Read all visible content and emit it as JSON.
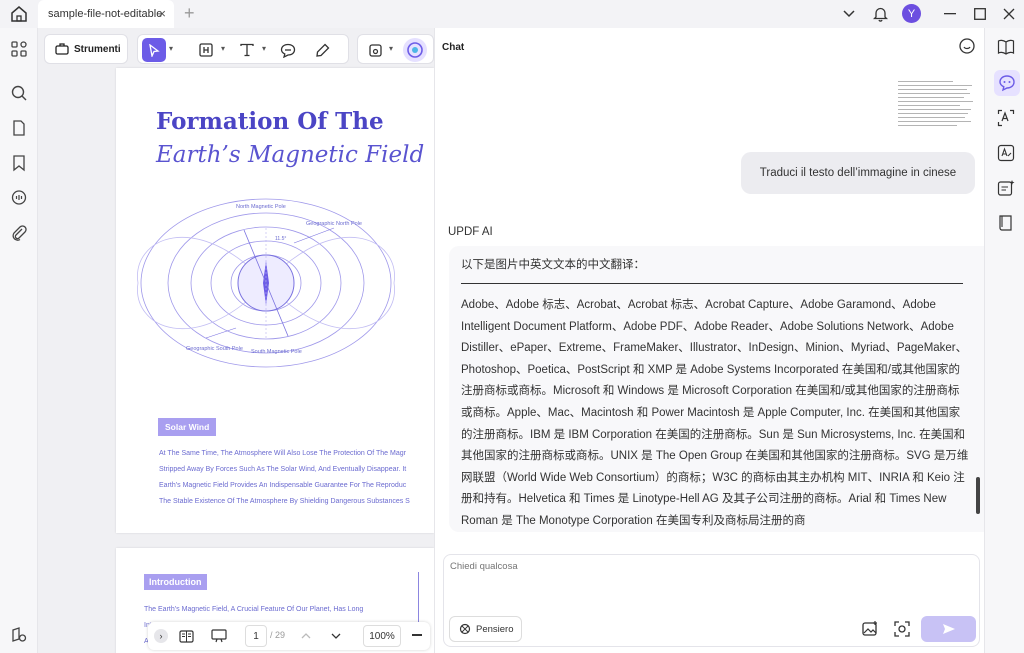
{
  "tab": {
    "title": "sample-file-not-editable"
  },
  "toolbar": {
    "strumenti_label": "Strumenti"
  },
  "document": {
    "page1": {
      "title_line1": "Formation Of The",
      "title_line2": "Earth’s Magnetic Field",
      "diagram_labels": {
        "north_magnetic_pole": "North Magnetic Pole",
        "geographic_north_pole": "Geographic North Pole",
        "geographic_south_pole": "Geographic South Pole",
        "south_magnetic_pole": "South Magnetic Pole",
        "angle": "11.5°"
      },
      "solar_wind_label": "Solar Wind",
      "body_lines": [
        "At The Same Time, The Atmosphere Will Also Lose The Protection Of The Magr",
        "Stripped Away By Forces Such As The Solar Wind, And Eventually Disappear. It",
        "Earth’s Magnetic Field Provides An Indispensable Guarantee For The Reproduc",
        "The Stable Existence Of The Atmosphere By Shielding Dangerous Substances S"
      ]
    },
    "page2": {
      "introduction_label": "Introduction",
      "body_lines": [
        "The Earth’s Magnetic Field, A Crucial Feature Of Our Planet, Has Long",
        "Int",
        "An"
      ]
    }
  },
  "pagenav": {
    "current_page": "1",
    "total_pages": "/ 29",
    "zoom": "100%"
  },
  "chat": {
    "title": "Chat",
    "user_message": "Traduci il testo dell’immagine in cinese",
    "ai_label": "UPDF AI",
    "ai_heading": "以下是图片中英文文本的中文翻译：",
    "ai_text": "Adobe、Adobe 标志、Acrobat、Acrobat 标志、Acrobat Capture、Adobe Garamond、Adobe Intelligent Document Platform、Adobe PDF、Adobe Reader、Adobe Solutions Network、Adobe Distiller、ePaper、Extreme、FrameMaker、Illustrator、InDesign、Minion、Myriad、PageMaker、Photoshop、Poetica、PostScript 和 XMP 是 Adobe Systems Incorporated 在美国和/或其他国家的注册商标或商标。Microsoft 和 Windows 是 Microsoft Corporation 在美国和/或其他国家的注册商标或商标。Apple、Mac、Macintosh 和 Power Macintosh 是 Apple Computer, Inc. 在美国和其他国家的注册商标。IBM 是 IBM Corporation 在美国的注册商标。Sun 是 Sun Microsystems, Inc. 在美国和其他国家的注册商标或商标。UNIX 是 The Open Group 在美国和其他国家的注册商标。SVG 是万维网联盟（World Wide Web Consortium）的商标；W3C 的商标由其主办机构 MIT、INRIA 和 Keio 注册和持有。Helvetica 和 Times 是 Linotype-Hell AG 及其子公司注册的商标。Arial 和 Times New Roman 是 The Monotype Corporation 在美国专利及商标局注册的商",
    "input_placeholder": "Chiedi qualcosa",
    "pensiero_label": "Pensiero"
  },
  "user": {
    "avatar_initial": "Y"
  },
  "colors": {
    "accent": "#6c5ce7",
    "doc_title": "#4b45c5",
    "doc_text": "#6b6bd0",
    "label_bg": "#a99ff0"
  }
}
